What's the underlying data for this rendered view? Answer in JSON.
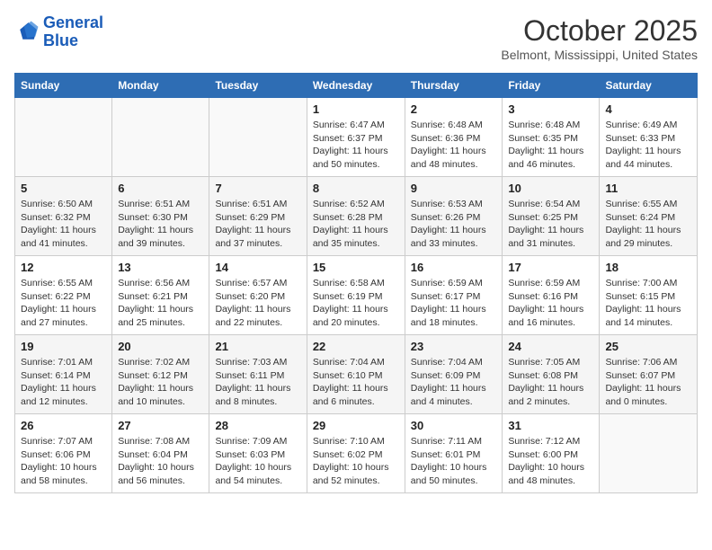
{
  "logo": {
    "line1": "General",
    "line2": "Blue"
  },
  "title": "October 2025",
  "subtitle": "Belmont, Mississippi, United States",
  "weekdays": [
    "Sunday",
    "Monday",
    "Tuesday",
    "Wednesday",
    "Thursday",
    "Friday",
    "Saturday"
  ],
  "weeks": [
    [
      {
        "day": "",
        "info": ""
      },
      {
        "day": "",
        "info": ""
      },
      {
        "day": "",
        "info": ""
      },
      {
        "day": "1",
        "info": "Sunrise: 6:47 AM\nSunset: 6:37 PM\nDaylight: 11 hours and 50 minutes."
      },
      {
        "day": "2",
        "info": "Sunrise: 6:48 AM\nSunset: 6:36 PM\nDaylight: 11 hours and 48 minutes."
      },
      {
        "day": "3",
        "info": "Sunrise: 6:48 AM\nSunset: 6:35 PM\nDaylight: 11 hours and 46 minutes."
      },
      {
        "day": "4",
        "info": "Sunrise: 6:49 AM\nSunset: 6:33 PM\nDaylight: 11 hours and 44 minutes."
      }
    ],
    [
      {
        "day": "5",
        "info": "Sunrise: 6:50 AM\nSunset: 6:32 PM\nDaylight: 11 hours and 41 minutes."
      },
      {
        "day": "6",
        "info": "Sunrise: 6:51 AM\nSunset: 6:30 PM\nDaylight: 11 hours and 39 minutes."
      },
      {
        "day": "7",
        "info": "Sunrise: 6:51 AM\nSunset: 6:29 PM\nDaylight: 11 hours and 37 minutes."
      },
      {
        "day": "8",
        "info": "Sunrise: 6:52 AM\nSunset: 6:28 PM\nDaylight: 11 hours and 35 minutes."
      },
      {
        "day": "9",
        "info": "Sunrise: 6:53 AM\nSunset: 6:26 PM\nDaylight: 11 hours and 33 minutes."
      },
      {
        "day": "10",
        "info": "Sunrise: 6:54 AM\nSunset: 6:25 PM\nDaylight: 11 hours and 31 minutes."
      },
      {
        "day": "11",
        "info": "Sunrise: 6:55 AM\nSunset: 6:24 PM\nDaylight: 11 hours and 29 minutes."
      }
    ],
    [
      {
        "day": "12",
        "info": "Sunrise: 6:55 AM\nSunset: 6:22 PM\nDaylight: 11 hours and 27 minutes."
      },
      {
        "day": "13",
        "info": "Sunrise: 6:56 AM\nSunset: 6:21 PM\nDaylight: 11 hours and 25 minutes."
      },
      {
        "day": "14",
        "info": "Sunrise: 6:57 AM\nSunset: 6:20 PM\nDaylight: 11 hours and 22 minutes."
      },
      {
        "day": "15",
        "info": "Sunrise: 6:58 AM\nSunset: 6:19 PM\nDaylight: 11 hours and 20 minutes."
      },
      {
        "day": "16",
        "info": "Sunrise: 6:59 AM\nSunset: 6:17 PM\nDaylight: 11 hours and 18 minutes."
      },
      {
        "day": "17",
        "info": "Sunrise: 6:59 AM\nSunset: 6:16 PM\nDaylight: 11 hours and 16 minutes."
      },
      {
        "day": "18",
        "info": "Sunrise: 7:00 AM\nSunset: 6:15 PM\nDaylight: 11 hours and 14 minutes."
      }
    ],
    [
      {
        "day": "19",
        "info": "Sunrise: 7:01 AM\nSunset: 6:14 PM\nDaylight: 11 hours and 12 minutes."
      },
      {
        "day": "20",
        "info": "Sunrise: 7:02 AM\nSunset: 6:12 PM\nDaylight: 11 hours and 10 minutes."
      },
      {
        "day": "21",
        "info": "Sunrise: 7:03 AM\nSunset: 6:11 PM\nDaylight: 11 hours and 8 minutes."
      },
      {
        "day": "22",
        "info": "Sunrise: 7:04 AM\nSunset: 6:10 PM\nDaylight: 11 hours and 6 minutes."
      },
      {
        "day": "23",
        "info": "Sunrise: 7:04 AM\nSunset: 6:09 PM\nDaylight: 11 hours and 4 minutes."
      },
      {
        "day": "24",
        "info": "Sunrise: 7:05 AM\nSunset: 6:08 PM\nDaylight: 11 hours and 2 minutes."
      },
      {
        "day": "25",
        "info": "Sunrise: 7:06 AM\nSunset: 6:07 PM\nDaylight: 11 hours and 0 minutes."
      }
    ],
    [
      {
        "day": "26",
        "info": "Sunrise: 7:07 AM\nSunset: 6:06 PM\nDaylight: 10 hours and 58 minutes."
      },
      {
        "day": "27",
        "info": "Sunrise: 7:08 AM\nSunset: 6:04 PM\nDaylight: 10 hours and 56 minutes."
      },
      {
        "day": "28",
        "info": "Sunrise: 7:09 AM\nSunset: 6:03 PM\nDaylight: 10 hours and 54 minutes."
      },
      {
        "day": "29",
        "info": "Sunrise: 7:10 AM\nSunset: 6:02 PM\nDaylight: 10 hours and 52 minutes."
      },
      {
        "day": "30",
        "info": "Sunrise: 7:11 AM\nSunset: 6:01 PM\nDaylight: 10 hours and 50 minutes."
      },
      {
        "day": "31",
        "info": "Sunrise: 7:12 AM\nSunset: 6:00 PM\nDaylight: 10 hours and 48 minutes."
      },
      {
        "day": "",
        "info": ""
      }
    ]
  ]
}
